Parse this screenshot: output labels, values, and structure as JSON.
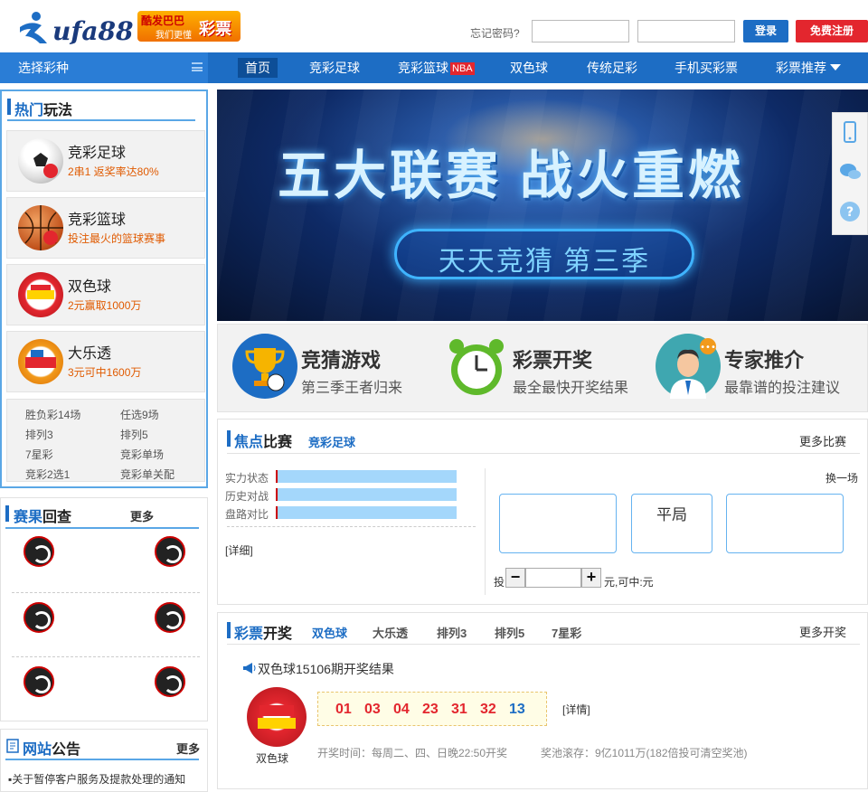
{
  "header": {
    "logo_text": "ufa88",
    "slogan_line1": "酷发巴巴",
    "slogan_line2": "我们更懂",
    "slogan_brand": "彩票",
    "forgot_password": "忘记密码?",
    "username_placeholder": "",
    "password_placeholder": "",
    "login_button": "登录",
    "register_button": "免费注册",
    "colors": {
      "brand_blue": "#1d6dc4",
      "register_red": "#e3262e"
    }
  },
  "nav": {
    "select_lottery": "选择彩种",
    "items": [
      "首页",
      "竞彩足球",
      "竞彩篮球",
      "双色球",
      "传统足彩",
      "手机买彩票",
      "彩票推荐"
    ],
    "nba_badge": "NBA"
  },
  "hot": {
    "title_a": "热门",
    "title_b": "玩法",
    "games": [
      {
        "name": "竞彩足球",
        "desc": "2串1 返奖率达80%",
        "icon": "soccer-ball-icon"
      },
      {
        "name": "竞彩篮球",
        "desc": "投注最火的篮球赛事",
        "icon": "basketball-icon"
      },
      {
        "name": "双色球",
        "desc": "2元赢取1000万",
        "icon": "shuangseqiu-logo-icon"
      },
      {
        "name": "大乐透",
        "desc": "3元可中1600万",
        "icon": "daletou-logo-icon"
      }
    ],
    "more_games": [
      "胜负彩14场",
      "任选9场",
      "排列3",
      "排列5",
      "7星彩",
      "竞彩单场",
      "竞彩2选1",
      "竞彩单关配"
    ]
  },
  "results": {
    "title_a": "赛果",
    "title_b": "回查",
    "more": "更多"
  },
  "notice": {
    "title_a": "网站",
    "title_b": "公告",
    "more": "更多",
    "items": [
      "关于暂停客户服务及提款处理的通知"
    ]
  },
  "banner": {
    "headline": "五大联赛 战火重燃",
    "subline": "天天竞猜 第三季"
  },
  "features": [
    {
      "title": "竞猜游戏",
      "desc": "第三季王者归来",
      "icon": "trophy-icon"
    },
    {
      "title": "彩票开奖",
      "desc": "最全最快开奖结果",
      "icon": "alarm-clock-icon"
    },
    {
      "title": "专家推介",
      "desc": "最靠谱的投注建议",
      "icon": "expert-avatar-icon"
    }
  ],
  "focus": {
    "title_a": "焦点",
    "title_b": "比赛",
    "tab": "竞彩足球",
    "more": "更多比赛",
    "change": "换一场",
    "rows": [
      "实力状态",
      "历史对战",
      "盘路对比"
    ],
    "detail": "[详细]",
    "draw": "平局",
    "bet_prefix": "投",
    "bet_suffix": "元,可中:元",
    "minus": "−",
    "plus": "+"
  },
  "lottery": {
    "title_a": "彩票",
    "title_b": "开奖",
    "tabs": [
      "双色球",
      "大乐透",
      "排列3",
      "排列5",
      "7星彩"
    ],
    "more": "更多开奖",
    "result_title": "双色球15106期开奖结果",
    "red_balls": [
      "01",
      "03",
      "04",
      "23",
      "31",
      "32"
    ],
    "blue_ball": "13",
    "detail": "[详情]",
    "logo_caption": "双色球",
    "draw_time": "开奖时间：每周二、四、日晚22:50开奖",
    "pool": "奖池滚存：9亿1011万(182倍投可清空奖池)"
  }
}
